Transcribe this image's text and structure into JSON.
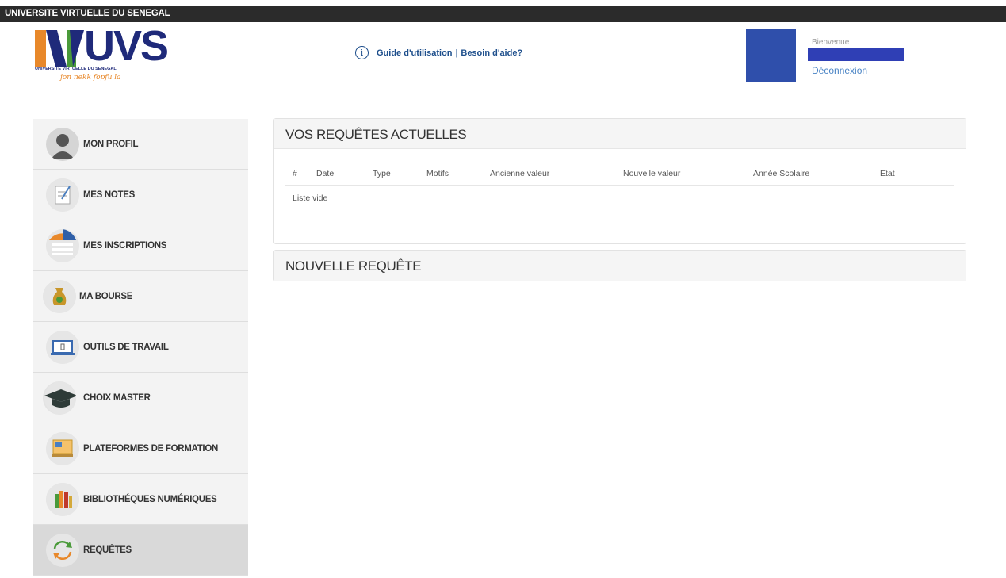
{
  "topbar": {
    "title": "UNIVERSITE VIRTUELLE DU SENEGAL"
  },
  "logo": {
    "text": "UVS",
    "subtitle": "UNIVERSITE VIRTUELLE DU SENEGAL",
    "slogan": "jon nekk fopfu la"
  },
  "help": {
    "icon": "info-icon",
    "guide_label": "Guide d'utilisation",
    "separator": "|",
    "help_label": "Besoin d'aide?"
  },
  "user": {
    "welcome": "Bienvenue",
    "logout_label": "Déconnexion"
  },
  "sidebar": {
    "items": [
      {
        "label": "MON PROFIL",
        "icon": "user-icon"
      },
      {
        "label": "MES NOTES",
        "icon": "notes-icon"
      },
      {
        "label": "MES INSCRIPTIONS",
        "icon": "registration-icon"
      },
      {
        "label": "MA BOURSE",
        "icon": "money-bag-icon"
      },
      {
        "label": "OUTILS DE TRAVAIL",
        "icon": "laptop-icon"
      },
      {
        "label": "CHOIX MASTER",
        "icon": "graduation-cap-icon"
      },
      {
        "label": "PLATEFORMES DE FORMATION",
        "icon": "training-platform-icon"
      },
      {
        "label": "BIBLIOTHÉQUES NUMÉRIQUES",
        "icon": "books-icon"
      },
      {
        "label": "REQUÊTES",
        "icon": "refresh-icon",
        "active": true
      }
    ]
  },
  "main": {
    "current_requests": {
      "title": "VOS REQUÊTES ACTUELLES",
      "columns": [
        "#",
        "Date",
        "Type",
        "Motifs",
        "Ancienne valeur",
        "Nouvelle valeur",
        "Année Scolaire",
        "Etat"
      ],
      "empty_text": "Liste vide"
    },
    "new_request": {
      "title": "NOUVELLE REQUÊTE"
    }
  },
  "colors": {
    "topbar": "#2b2b2b",
    "brand_blue": "#1f2a7a",
    "brand_orange": "#e8882a",
    "link_blue": "#1e4f8c",
    "redaction_blue": "#2f3fb5"
  }
}
